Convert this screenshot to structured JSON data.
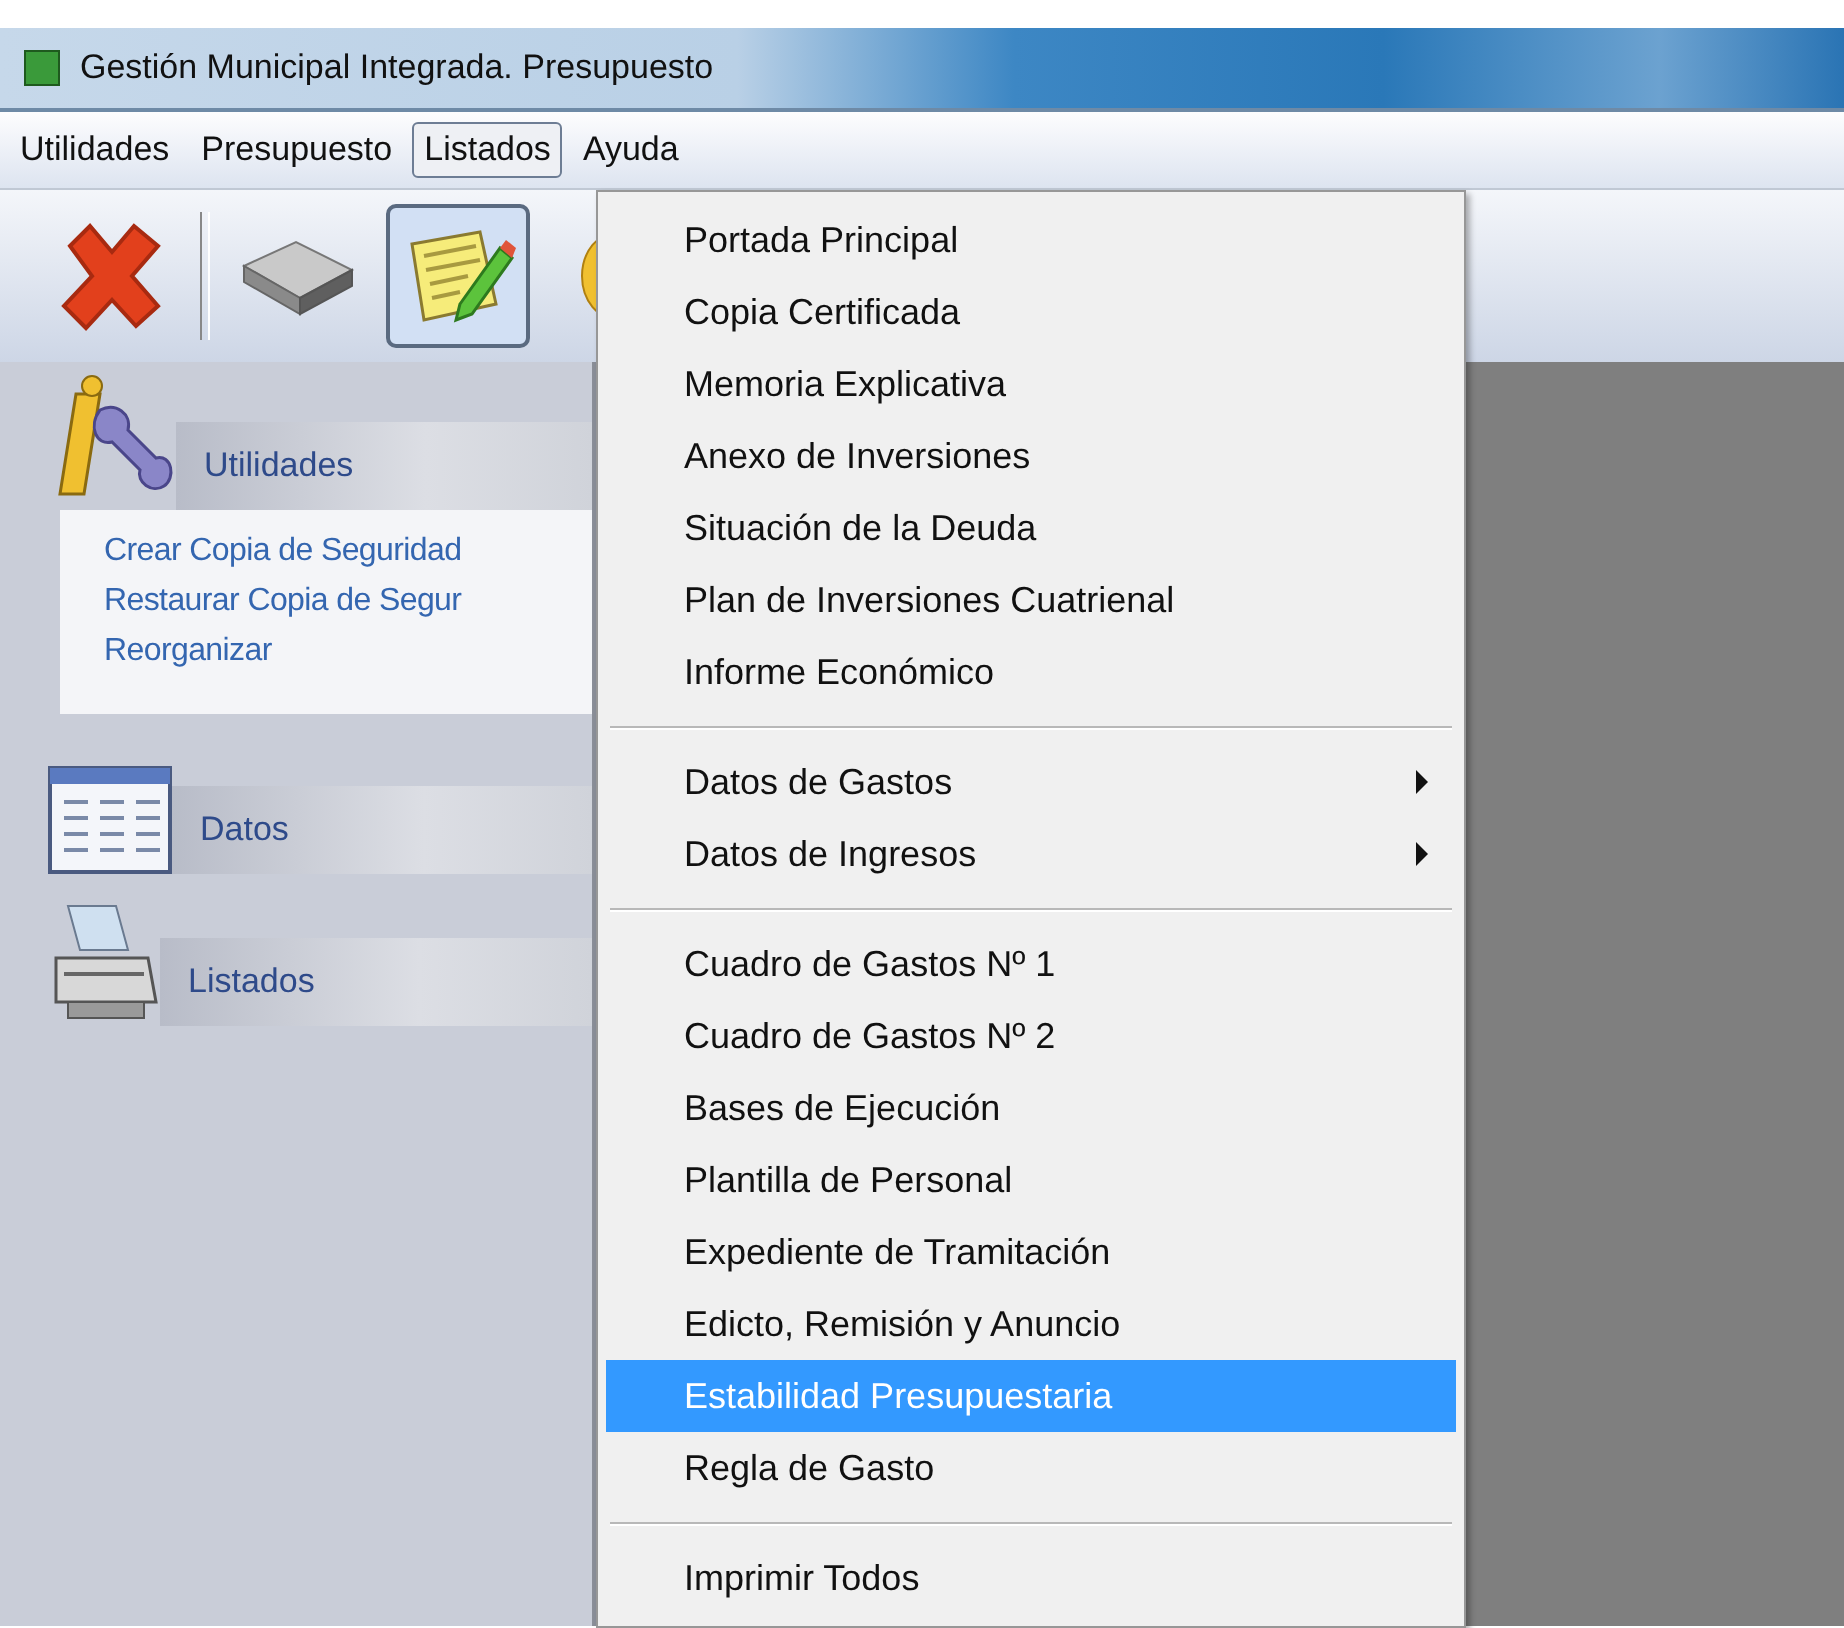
{
  "window": {
    "title": "Gestión Municipal Integrada. Presupuesto"
  },
  "menu_bar": [
    {
      "label": "Utilidades",
      "selected": false
    },
    {
      "label": "Presupuesto",
      "selected": false
    },
    {
      "label": "Listados",
      "selected": true
    },
    {
      "label": "Ayuda",
      "selected": false
    }
  ],
  "toolbar": [
    {
      "kind": "delete",
      "pressed": false
    },
    {
      "kind": "drive",
      "pressed": false
    },
    {
      "kind": "notepad",
      "pressed": true
    },
    {
      "kind": "coin",
      "pressed": false
    }
  ],
  "sidebar": {
    "groups": [
      {
        "kind": "tools",
        "title": "Utilidades",
        "expanded": true,
        "items": [
          "Crear Copia de Seguridad",
          "Restaurar Copia de Segur",
          "Reorganizar"
        ]
      },
      {
        "kind": "table",
        "title": "Datos",
        "expanded": false
      },
      {
        "kind": "printer",
        "title": "Listados",
        "expanded": false
      }
    ]
  },
  "dropdown": {
    "items": [
      {
        "kind": "item",
        "label": "Portada Principal",
        "selected": false
      },
      {
        "kind": "item",
        "label": "Copia Certificada",
        "selected": false
      },
      {
        "kind": "item",
        "label": "Memoria Explicativa",
        "selected": false
      },
      {
        "kind": "item",
        "label": "Anexo de Inversiones",
        "selected": false
      },
      {
        "kind": "item",
        "label": "Situación de la Deuda",
        "selected": false
      },
      {
        "kind": "item",
        "label": "Plan de Inversiones Cuatrienal",
        "selected": false
      },
      {
        "kind": "item",
        "label": "Informe Económico",
        "selected": false
      },
      {
        "kind": "separator"
      },
      {
        "kind": "submenu",
        "label": "Datos de Gastos",
        "selected": false
      },
      {
        "kind": "submenu",
        "label": "Datos de Ingresos",
        "selected": false
      },
      {
        "kind": "separator"
      },
      {
        "kind": "item",
        "label": "Cuadro de Gastos Nº 1",
        "selected": false
      },
      {
        "kind": "item",
        "label": "Cuadro de Gastos Nº 2",
        "selected": false
      },
      {
        "kind": "item",
        "label": "Bases de Ejecución",
        "selected": false
      },
      {
        "kind": "item",
        "label": "Plantilla de Personal",
        "selected": false
      },
      {
        "kind": "item",
        "label": "Expediente de Tramitación",
        "selected": false
      },
      {
        "kind": "item",
        "label": "Edicto, Remisión y Anuncio",
        "selected": false
      },
      {
        "kind": "item",
        "label": "Estabilidad Presupuestaria",
        "selected": true
      },
      {
        "kind": "item",
        "label": "Regla de Gasto",
        "selected": false
      },
      {
        "kind": "separator"
      },
      {
        "kind": "item",
        "label": "Imprimir Todos",
        "selected": false
      }
    ]
  }
}
